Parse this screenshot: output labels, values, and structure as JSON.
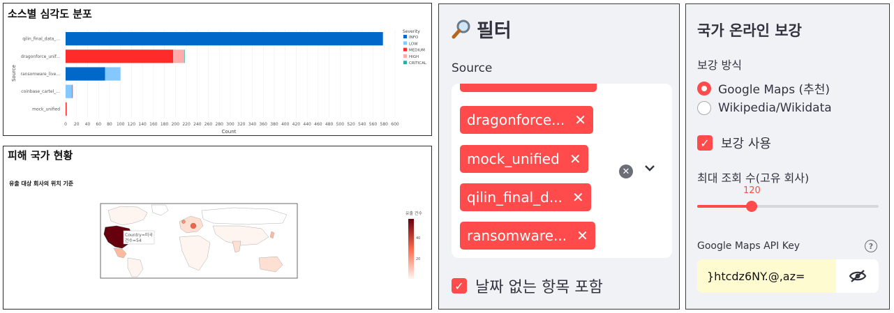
{
  "severity_chart": {
    "title": "소스별 심각도 분포",
    "chart_data": {
      "type": "bar",
      "orientation": "horizontal",
      "stacked": true,
      "xlabel": "Count",
      "ylabel": "Source",
      "xlim": [
        0,
        600
      ],
      "x_ticks": [
        "0",
        "20",
        "40",
        "60",
        "80",
        "100",
        "120",
        "140",
        "160",
        "180",
        "200",
        "220",
        "240",
        "260",
        "280",
        "300",
        "320",
        "340",
        "360",
        "380",
        "400",
        "420",
        "440",
        "460",
        "480",
        "500",
        "520",
        "540",
        "560",
        "580",
        "600"
      ],
      "categories": [
        "qilin_final_data_...",
        "dragonforce_unif...",
        "ransomware_live...",
        "coinbase_cartel_...",
        "mock_unified"
      ],
      "legend_title": "Severity",
      "legend_position": "right",
      "grid": true,
      "series": [
        {
          "name": "INFO",
          "color": "#0068c9",
          "values": [
            578,
            0,
            72,
            0,
            0
          ]
        },
        {
          "name": "LOW",
          "color": "#83c9ff",
          "values": [
            0,
            0,
            28,
            12,
            0
          ]
        },
        {
          "name": "MEDIUM",
          "color": "#ff2b2b",
          "values": [
            0,
            196,
            0,
            1,
            2
          ]
        },
        {
          "name": "HIGH",
          "color": "#ffabab",
          "values": [
            0,
            20,
            0,
            0,
            0
          ]
        },
        {
          "name": "CRITICAL",
          "color": "#29b09d",
          "values": [
            0,
            1,
            0,
            0,
            0
          ]
        }
      ]
    }
  },
  "country_map": {
    "title": "피해 국가 현황",
    "subtitle": "유출 대상 회사의 위치 기준",
    "colorbar_title": "유출 건수",
    "colorbar_ticks": [
      "40",
      "20"
    ],
    "colorbar_max": 54,
    "tooltip_line1": "Country=미국",
    "tooltip_line2": "건수=54",
    "highlight_colors": {
      "high": "#67000d",
      "mid": "#ef6548",
      "low": "#fee0d2"
    }
  },
  "filter": {
    "icon": "magnifier-icon",
    "title": "필터",
    "source_label": "Source",
    "tags": [
      "dragonforce...",
      "mock_unified",
      "qilin_final_d...",
      "ransomware..."
    ],
    "clear_icon": "clear-icon",
    "dropdown_icon": "chevron-down-icon",
    "include_no_date_label": "날짜 없는 항목 포함",
    "include_no_date_checked": true
  },
  "enrichment": {
    "title": "국가 온라인 보강",
    "method_label": "보강 방식",
    "methods": [
      "Google Maps (추천)",
      "Wikipedia/Wikidata"
    ],
    "selected_method": "Google Maps (추천)",
    "enable_label": "보강 사용",
    "enable_checked": true,
    "max_label": "최대 조회 수(고유 회사)",
    "max_value": "120",
    "max_value_fraction": 0.3,
    "api_key_label": "Google Maps API Key",
    "api_key_value": "}htcdz6NY.@,az=",
    "eye_icon": "eye-slash-icon",
    "help_icon": "help-icon"
  },
  "colors": {
    "accent": "#ff4b4b",
    "sidebar_bg": "#f0f2f6"
  }
}
